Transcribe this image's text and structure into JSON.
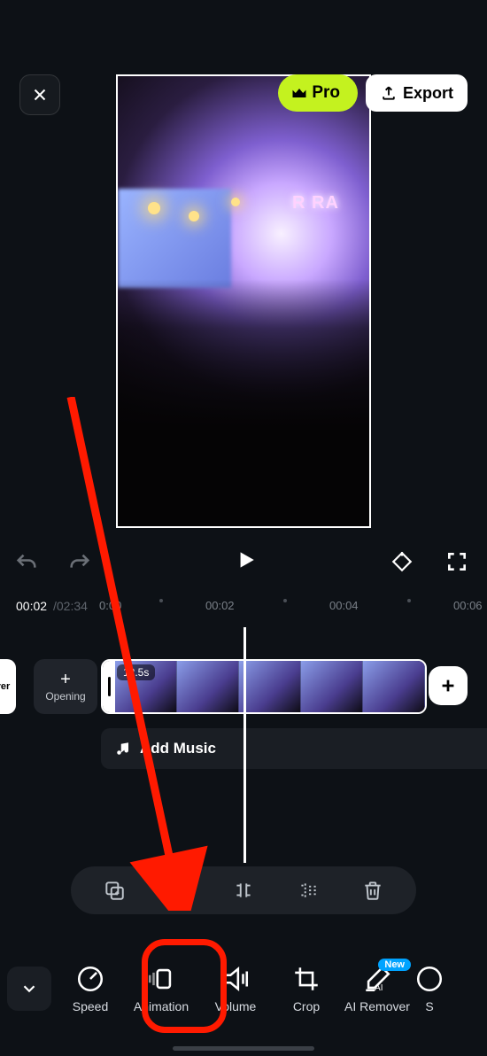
{
  "header": {
    "pro_label": "Pro",
    "export_label": "Export"
  },
  "preview": {
    "stage_text": "R RA"
  },
  "timeline": {
    "current_time": "00:02",
    "total_time": "/02:34",
    "tick_0": "0:00",
    "tick_2": "00:02",
    "tick_4": "00:04",
    "tick_6": "00:06",
    "clip_duration": "12.5s",
    "opening_label": "Opening",
    "cover_label": "ver",
    "add_music_label": "Add Music"
  },
  "tools": {
    "speed": "Speed",
    "animation": "Animation",
    "volume": "Volume",
    "crop": "Crop",
    "ai_remover": "AI Remover",
    "next_partial": "S",
    "new_badge": "New"
  }
}
